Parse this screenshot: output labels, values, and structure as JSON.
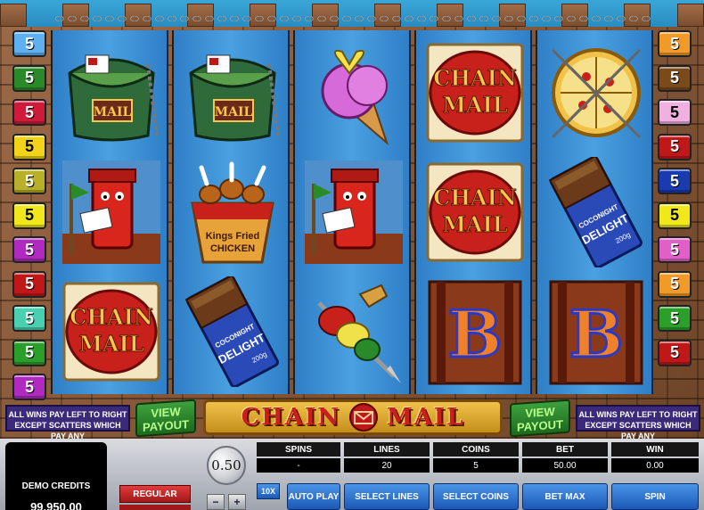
{
  "game": {
    "title": "CHAIN MAIL"
  },
  "left_badges": [
    {
      "value": "5",
      "color": "#5fb0f0",
      "text": "dark"
    },
    {
      "value": "5",
      "color": "#2a8a2a",
      "text": "dark"
    },
    {
      "value": "5",
      "color": "#d01a3a",
      "text": "dark"
    },
    {
      "value": "5",
      "color": "#f2d31a",
      "text": "light"
    },
    {
      "value": "5",
      "color": "#b8b02a",
      "text": "dark"
    },
    {
      "value": "5",
      "color": "#f0e81a",
      "text": "light"
    },
    {
      "value": "5",
      "color": "#b02ac0",
      "text": "dark"
    },
    {
      "value": "5",
      "color": "#c01818",
      "text": "dark"
    },
    {
      "value": "5",
      "color": "#4ad0b0",
      "text": "dark"
    },
    {
      "value": "5",
      "color": "#2aa02a",
      "text": "dark"
    },
    {
      "value": "5",
      "color": "#b02ac0",
      "text": "dark"
    }
  ],
  "right_badges": [
    {
      "value": "5",
      "color": "#f09a2a",
      "text": "dark"
    },
    {
      "value": "5",
      "color": "#7a4a1a",
      "text": "dark"
    },
    {
      "value": "5",
      "color": "#f0b0e0",
      "text": "light"
    },
    {
      "value": "5",
      "color": "#c01818",
      "text": "dark"
    },
    {
      "value": "5",
      "color": "#1a3ab0",
      "text": "dark"
    },
    {
      "value": "5",
      "color": "#f0e81a",
      "text": "light"
    },
    {
      "value": "5",
      "color": "#e060c8",
      "text": "dark"
    },
    {
      "value": "5",
      "color": "#f09a2a",
      "text": "dark"
    },
    {
      "value": "5",
      "color": "#2aa02a",
      "text": "dark"
    },
    {
      "value": "5",
      "color": "#c01818",
      "text": "dark"
    }
  ],
  "reels": [
    [
      "mailbag",
      "mailbox",
      "chain-mail"
    ],
    [
      "mailbag",
      "fried-chicken",
      "chocolate"
    ],
    [
      "ice-cream",
      "mailbox",
      "kebab"
    ],
    [
      "chain-mail",
      "chain-mail",
      "b-door"
    ],
    [
      "pizza",
      "chocolate",
      "b-door"
    ]
  ],
  "symbol_text": {
    "chain_mail_1": "CHAIN",
    "chain_mail_2": "MAIL",
    "kfc_1": "Kings Fried",
    "kfc_2": "CHICKEN",
    "choc_1": "COCONIGHT",
    "choc_2": "DELIGHT",
    "choc_3": "200g",
    "mailbag_sign": "MAIL",
    "b_letter": "B"
  },
  "info": {
    "left_note_1": "ALL WINS PAY LEFT TO RIGHT",
    "left_note_2": "EXCEPT SCATTERS WHICH PAY ANY",
    "right_note_1": "ALL WINS PAY LEFT TO RIGHT",
    "right_note_2": "EXCEPT SCATTERS WHICH PAY ANY",
    "view_payout_1": "VIEW",
    "view_payout_2": "PAYOUT",
    "logo_left": "CHAIN",
    "logo_right": "MAIL"
  },
  "panel": {
    "credits_label": "DEMO CREDITS",
    "credits_value": "99,950.00",
    "regular": "REGULAR",
    "coin_value": "0.50",
    "minus": "−",
    "plus": "+",
    "x10": "10X",
    "stats": {
      "spins_label": "SPINS",
      "spins_value": "-",
      "lines_label": "LINES",
      "lines_value": "20",
      "coins_label": "COINS",
      "coins_value": "5",
      "bet_label": "BET",
      "bet_value": "50.00",
      "win_label": "WIN",
      "win_value": "0.00"
    },
    "auto_play": "AUTO PLAY",
    "select_lines": "SELECT LINES",
    "select_coins": "SELECT COINS",
    "bet_max": "BET MAX",
    "spin": "SPIN"
  }
}
